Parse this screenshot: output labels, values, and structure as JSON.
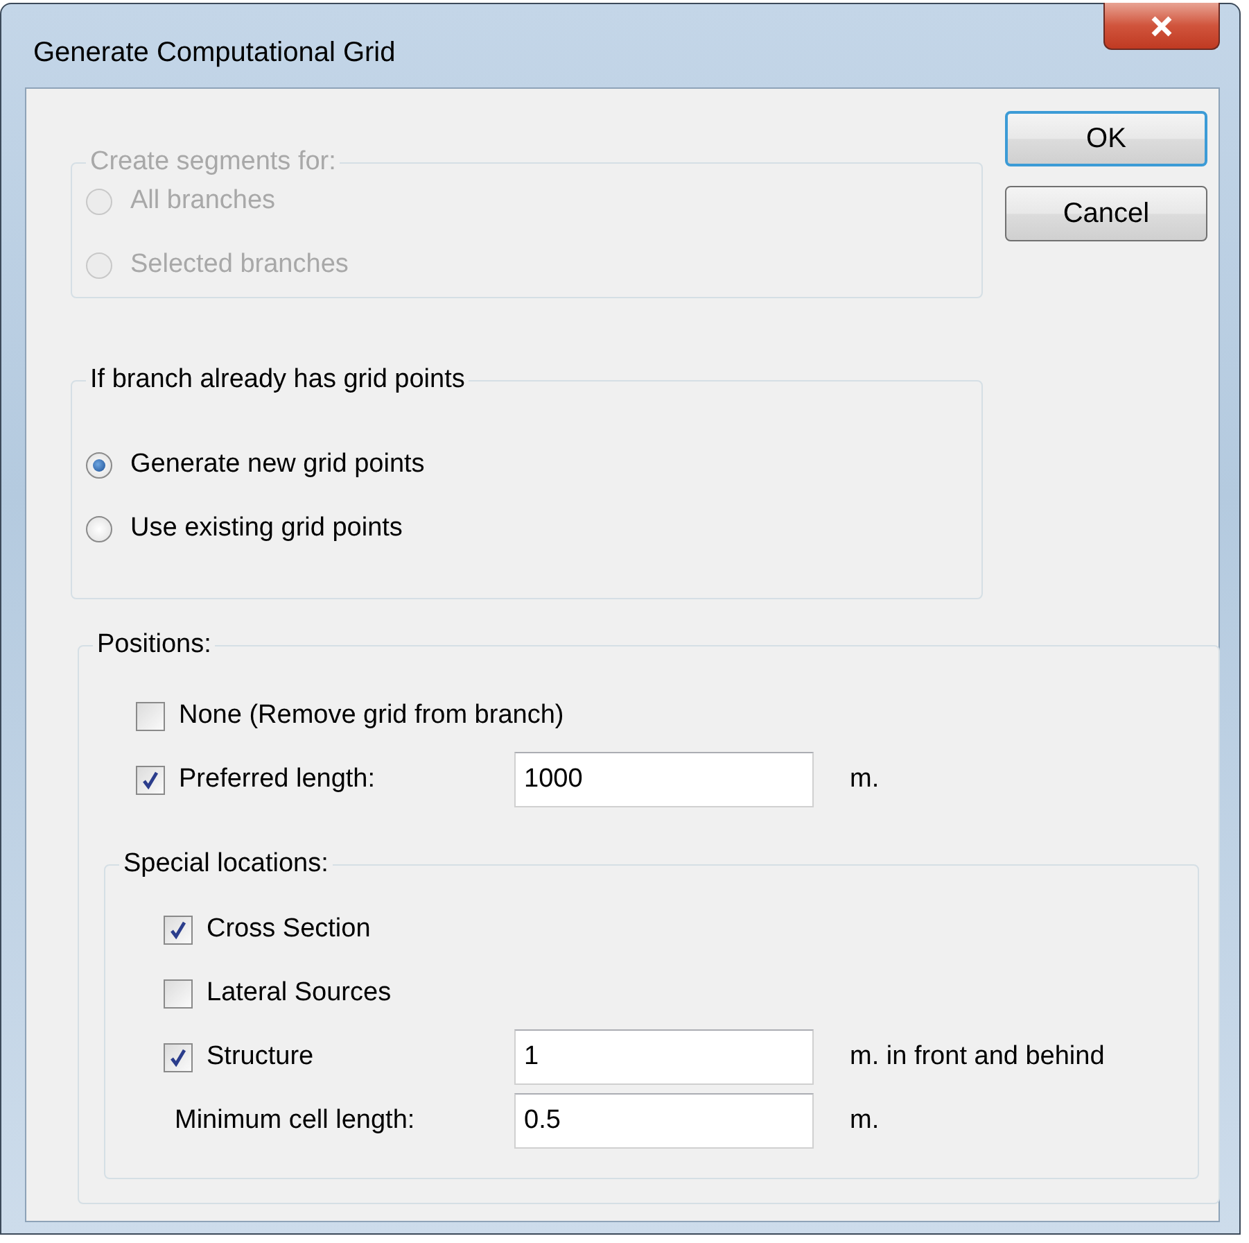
{
  "window": {
    "title": "Generate Computational Grid"
  },
  "buttons": [
    {
      "label": "OK",
      "default": true
    },
    {
      "label": "Cancel",
      "default": false
    }
  ],
  "segments_group": {
    "title": "Create segments for:",
    "disabled": true,
    "options": [
      {
        "label": "All branches",
        "selected": false
      },
      {
        "label": "Selected branches",
        "selected": false
      }
    ]
  },
  "existing_group": {
    "title": "If branch already has grid points",
    "disabled": false,
    "options": [
      {
        "label": "Generate new grid points",
        "selected": true
      },
      {
        "label": "Use existing grid points",
        "selected": false
      }
    ]
  },
  "positions": {
    "title": "Positions:",
    "rows": [
      {
        "kind": "checkbox",
        "label": "None (Remove grid from branch)",
        "checked": false
      },
      {
        "kind": "checkbox",
        "label": "Preferred length:",
        "checked": true,
        "value": "1000",
        "unit": "m."
      }
    ],
    "special": {
      "title": "Special locations:",
      "rows": [
        {
          "kind": "checkbox",
          "label": "Cross Section",
          "checked": true
        },
        {
          "kind": "checkbox",
          "label": "Lateral Sources",
          "checked": false
        },
        {
          "kind": "checkbox",
          "label": "Structure",
          "checked": true,
          "value": "1",
          "unit": "m. in front and behind"
        },
        {
          "kind": "field",
          "label": "Minimum cell length:",
          "value": "0.5",
          "unit": "m."
        }
      ]
    }
  }
}
